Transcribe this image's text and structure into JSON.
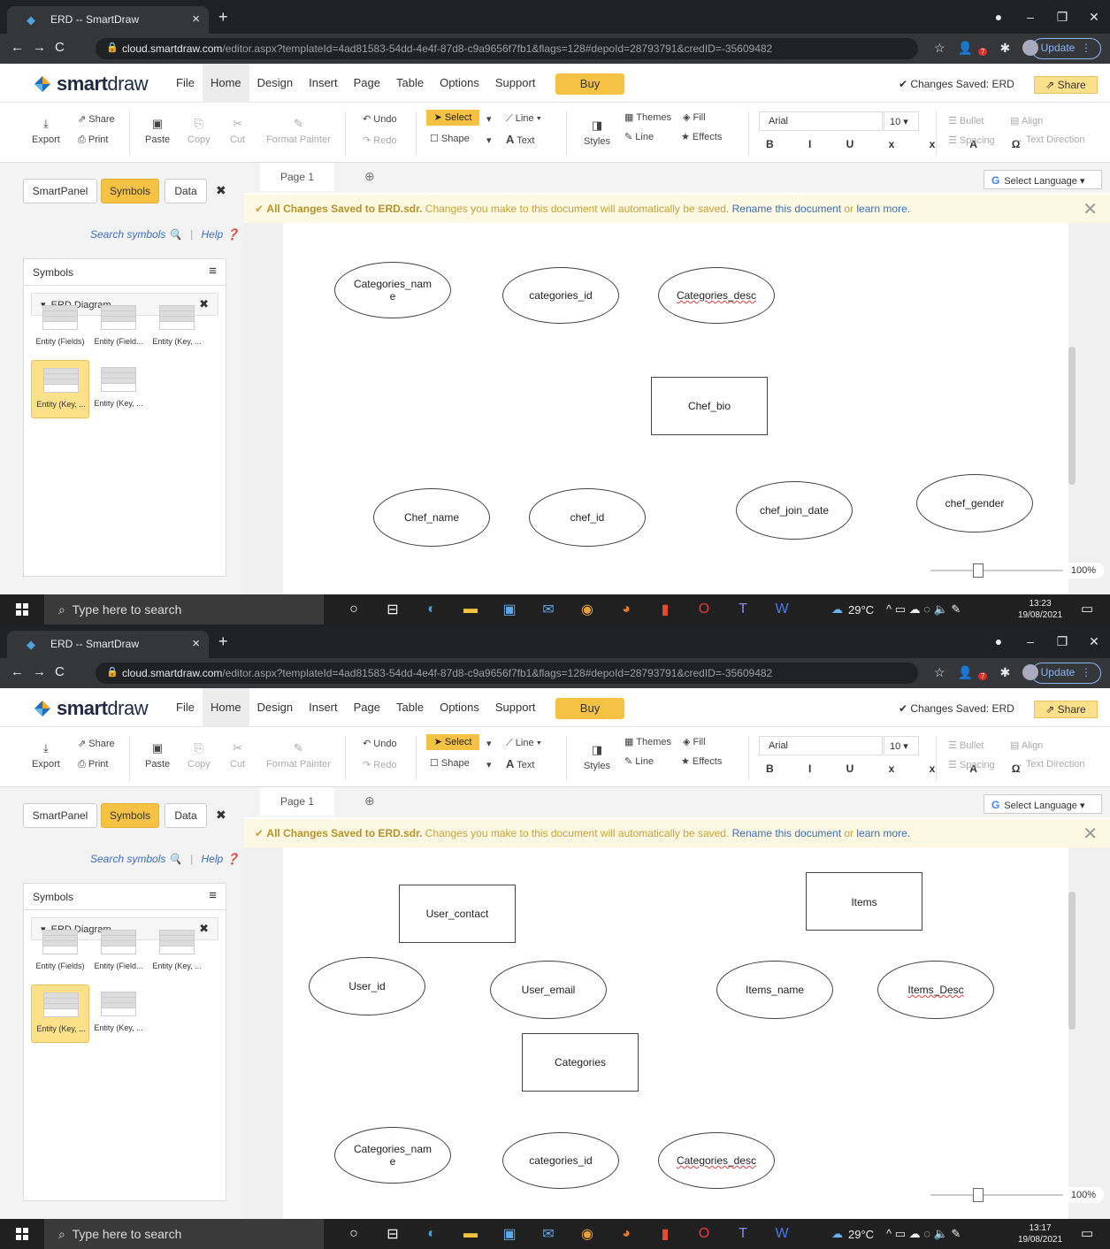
{
  "browser": {
    "tab_title": "ERD -- SmartDraw",
    "url_domain": "cloud.smartdraw.com",
    "url_path": "/editor.aspx?templateId=4ad81583-54dd-4e4f-87d8-c9a9656f7fb1&flags=128#depoId=28793791&credID=-35609482",
    "update_label": "Update",
    "ext_badge": "7"
  },
  "app": {
    "logo_bold": "smart",
    "logo_light": "draw",
    "menus": [
      "File",
      "Home",
      "Design",
      "Insert",
      "Page",
      "Table",
      "Options",
      "Support"
    ],
    "active_menu": "Home",
    "buy_label": "Buy",
    "saved_status": "Changes Saved: ERD",
    "share_label": "Share"
  },
  "ribbon": {
    "export": "Export",
    "share": "Share",
    "print": "Print",
    "paste": "Paste",
    "copy": "Copy",
    "cut": "Cut",
    "format_painter": "Format Painter",
    "undo": "Undo",
    "redo": "Redo",
    "select": "Select",
    "shape": "Shape",
    "line": "Line",
    "text": "Text",
    "styles": "Styles",
    "themes": "Themes",
    "fill": "Fill",
    "line2": "Line",
    "effects": "Effects",
    "font": "Arial",
    "font_size": "10",
    "bullet": "Bullet",
    "align": "Align",
    "spacing": "Spacing",
    "text_direction": "Text Direction"
  },
  "sidebar": {
    "tabs": [
      "SmartPanel",
      "Symbols",
      "Data"
    ],
    "active_tab": "Symbols",
    "search_label": "Search symbols",
    "help_label": "Help",
    "panel_title": "Symbols",
    "library": "ERD Diagram",
    "symbols": [
      "Entity (Fields)",
      "Entity (Field...",
      "Entity (Key, ...",
      "Entity (Key, ...",
      "Entity (Key, ..."
    ]
  },
  "page_tab": "Page 1",
  "language_label": "Select Language",
  "notice": {
    "bold": "All Changes Saved to ERD.sdr.",
    "text": " Changes you make to this document will automatically be saved. ",
    "link1": "Rename this document",
    "or": " or ",
    "link2": "learn more."
  },
  "zoom_level": "100%",
  "taskbar": {
    "search_placeholder": "Type here to search",
    "weather": "29°C"
  },
  "screenshots": [
    {
      "time": "13:23",
      "date": "19/08/2021",
      "shapes": [
        {
          "type": "attribute",
          "label_line1": "Categories_nam",
          "label_line2": "e"
        },
        {
          "type": "attribute",
          "label_line1": "categories_id",
          "label_line2": ""
        },
        {
          "type": "attribute",
          "label_line1": "Categories_desc",
          "label_line2": ""
        },
        {
          "type": "entity",
          "label_line1": "Chef_bio",
          "label_line2": ""
        },
        {
          "type": "attribute",
          "label_line1": "Chef_name",
          "label_line2": ""
        },
        {
          "type": "attribute",
          "label_line1": "chef_id",
          "label_line2": ""
        },
        {
          "type": "attribute",
          "label_line1": "chef_join_date",
          "label_line2": ""
        },
        {
          "type": "attribute",
          "label_line1": "chef_gender",
          "label_line2": ""
        }
      ]
    },
    {
      "time": "13:17",
      "date": "19/08/2021",
      "shapes": [
        {
          "type": "entity",
          "label_line1": "User_contact",
          "label_line2": ""
        },
        {
          "type": "entity",
          "label_line1": "Items",
          "label_line2": ""
        },
        {
          "type": "attribute",
          "label_line1": "User_id",
          "label_line2": ""
        },
        {
          "type": "attribute",
          "label_line1": "User_email",
          "label_line2": ""
        },
        {
          "type": "attribute",
          "label_line1": "Items_name",
          "label_line2": ""
        },
        {
          "type": "attribute",
          "label_line1": "Items_Desc",
          "label_line2": ""
        },
        {
          "type": "entity",
          "label_line1": "Categories",
          "label_line2": ""
        },
        {
          "type": "attribute",
          "label_line1": "Categories_nam",
          "label_line2": "e"
        },
        {
          "type": "attribute",
          "label_line1": "categories_id",
          "label_line2": ""
        },
        {
          "type": "attribute",
          "label_line1": "Categories_desc",
          "label_line2": ""
        }
      ]
    }
  ],
  "colors": {
    "accent": "#f6c244",
    "link": "#3a6fc4",
    "chrome_dark": "#202124"
  }
}
